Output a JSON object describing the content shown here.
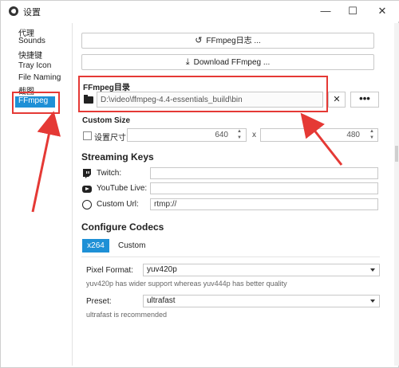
{
  "window": {
    "title": "设置",
    "minimize_glyph": "—",
    "maximize_glyph": "☐",
    "close_glyph": "✕"
  },
  "sidebar": {
    "items": [
      {
        "label": "代理"
      },
      {
        "label": "Sounds"
      },
      {
        "label": "快捷键"
      },
      {
        "label": "Tray Icon"
      },
      {
        "label": "File Naming"
      },
      {
        "label": "截图"
      },
      {
        "label": "FFmpeg",
        "active": true
      }
    ]
  },
  "main": {
    "ffmpeg_log_button": "FFmpeg日志 ...",
    "download_ffmpeg_button": "Download FFmpeg ...",
    "ffmpeg_dir_label": "FFmpeg目录",
    "ffmpeg_path": "D:\\video\\ffmpeg-4.4-essentials_build\\bin",
    "clear_button": "✕",
    "browse_button": "•••",
    "custom_size": {
      "heading": "Custom Size",
      "checkbox_label": "设置尺寸",
      "width": "640",
      "separator": "x",
      "height": "480"
    },
    "streaming_keys": {
      "heading": "Streaming Keys",
      "twitch_label": "Twitch:",
      "twitch_value": "",
      "youtube_label": "YouTube Live:",
      "youtube_value": "",
      "custom_url_label": "Custom Url:",
      "custom_url_value": "rtmp://"
    },
    "configure_codecs": {
      "heading": "Configure Codecs",
      "tabs": [
        "x264",
        "Custom"
      ],
      "pixel_format_label": "Pixel Format:",
      "pixel_format_value": "yuv420p",
      "pixel_format_hint": "yuv420p has wider support whereas yuv444p has better quality",
      "preset_label": "Preset:",
      "preset_value": "ultrafast",
      "preset_hint": "ultrafast is recommended"
    }
  },
  "colors": {
    "accent": "#1e90d6",
    "annotation_red": "#e53935"
  },
  "icons": {
    "log_button_icon": "history-icon",
    "download_button_icon": "download-icon",
    "folder": "folder-icon",
    "twitch": "twitch-icon",
    "youtube": "youtube-icon",
    "custom_url": "globe-icon"
  }
}
